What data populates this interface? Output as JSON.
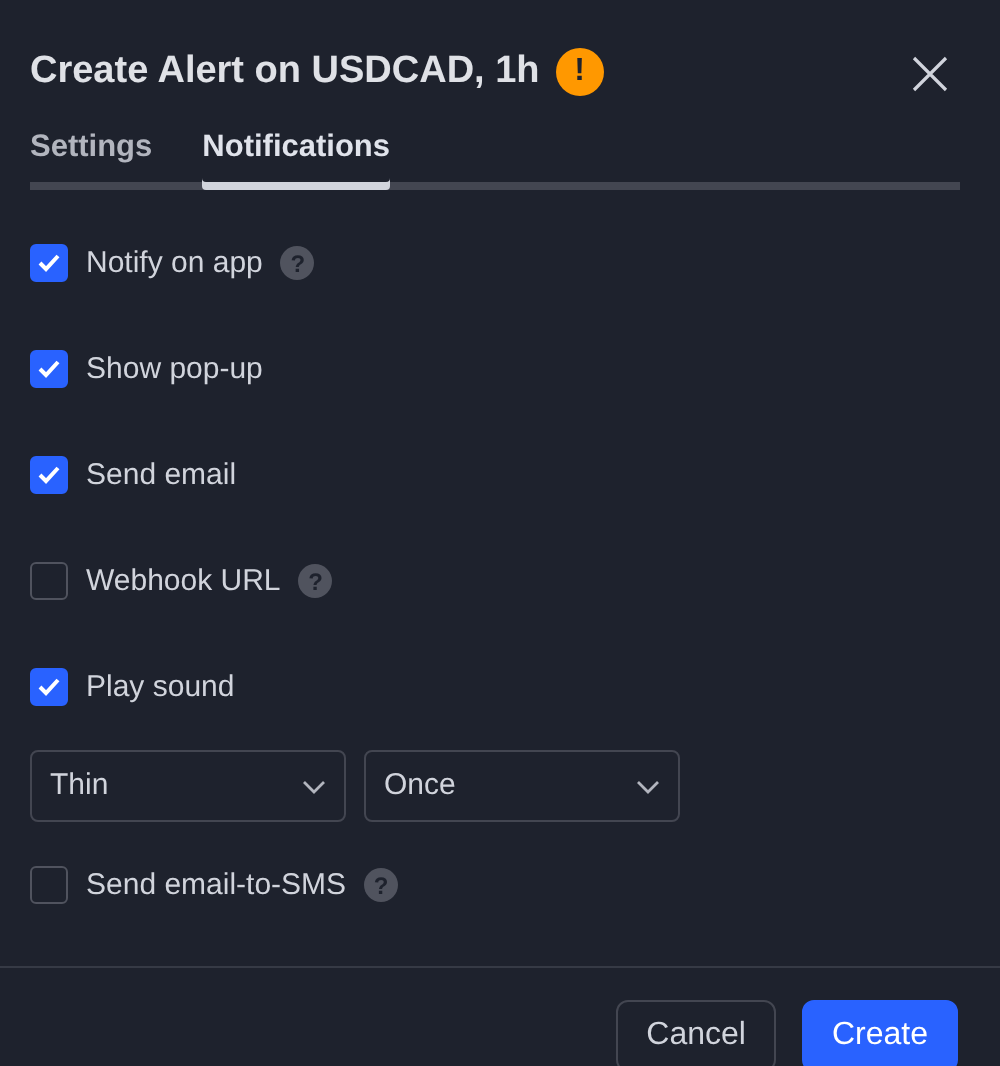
{
  "dialog": {
    "title": "Create Alert on USDCAD, 1h",
    "warning_icon": "!"
  },
  "tabs": [
    {
      "label": "Settings",
      "selected": false
    },
    {
      "label": "Notifications",
      "selected": true
    }
  ],
  "options": [
    {
      "kind": "checkbox",
      "label": "Notify on app",
      "checked": true,
      "help": "?"
    },
    {
      "kind": "checkbox",
      "label": "Show pop-up",
      "checked": true
    },
    {
      "kind": "checkbox",
      "label": "Send email",
      "checked": true
    },
    {
      "kind": "checkbox",
      "label": "Webhook URL",
      "checked": false,
      "help": "?"
    },
    {
      "kind": "checkbox",
      "label": "Play sound",
      "checked": true
    },
    {
      "kind": "selects",
      "values": [
        "Thin",
        "Once"
      ]
    },
    {
      "kind": "checkbox",
      "label": "Send email-to-SMS",
      "checked": false,
      "help": "?"
    }
  ],
  "buttons": [
    {
      "label": "Cancel",
      "kind": "secondary"
    },
    {
      "label": "Create",
      "kind": "primary"
    }
  ]
}
